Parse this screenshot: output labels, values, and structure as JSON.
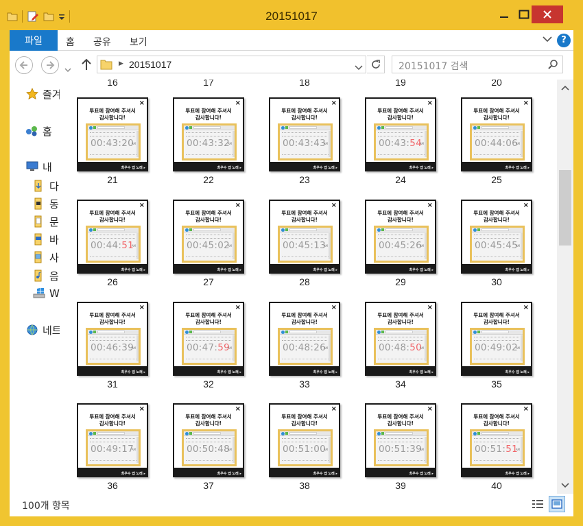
{
  "window": {
    "title": "20151017"
  },
  "ribbon": {
    "tabs": [
      "파일",
      "홈",
      "공유",
      "보기"
    ],
    "help": "?"
  },
  "address": {
    "crumb": "20151017",
    "search_placeholder": "20151017 검색"
  },
  "nav": {
    "items": [
      {
        "label": "즐겨",
        "icon": "star-icon"
      },
      {
        "label": "홈",
        "icon": "homegroup-icon"
      },
      {
        "label": "내",
        "icon": "computer-icon"
      },
      {
        "label": "다",
        "icon": "downloads-folder-icon"
      },
      {
        "label": "동",
        "icon": "videos-folder-icon"
      },
      {
        "label": "문",
        "icon": "documents-folder-icon"
      },
      {
        "label": "바",
        "icon": "desktop-folder-icon"
      },
      {
        "label": "사",
        "icon": "pictures-folder-icon"
      },
      {
        "label": "음",
        "icon": "music-folder-icon"
      },
      {
        "label": "W",
        "icon": "windows-drive-icon"
      },
      {
        "label": "네트",
        "icon": "network-icon"
      }
    ]
  },
  "header_labels": [
    "16",
    "17",
    "18",
    "19",
    "20"
  ],
  "thumbnail": {
    "heading_line1": "투표에 참여해 주셔서",
    "heading_line2": "감사합니다!",
    "footer": "최우수 앱 노래 ▸",
    "close": "×",
    "am": "AM"
  },
  "files": [
    {
      "name": "21",
      "hm": "00:43:",
      "sec": "20",
      "red": false
    },
    {
      "name": "22",
      "hm": "00:43:",
      "sec": "32",
      "red": false
    },
    {
      "name": "23",
      "hm": "00:43:",
      "sec": "43",
      "red": false
    },
    {
      "name": "24",
      "hm": "00:43:",
      "sec": "54",
      "red": true
    },
    {
      "name": "25",
      "hm": "00:44:",
      "sec": "06",
      "red": false
    },
    {
      "name": "26",
      "hm": "00:44:",
      "sec": "51",
      "red": true
    },
    {
      "name": "27",
      "hm": "00:45:",
      "sec": "02",
      "red": false
    },
    {
      "name": "28",
      "hm": "00:45:",
      "sec": "13",
      "red": false
    },
    {
      "name": "29",
      "hm": "00:45:",
      "sec": "26",
      "red": false
    },
    {
      "name": "30",
      "hm": "00:45:",
      "sec": "45",
      "red": false
    },
    {
      "name": "31",
      "hm": "00:46:",
      "sec": "39",
      "red": false
    },
    {
      "name": "32",
      "hm": "00:47:",
      "sec": "59",
      "red": true
    },
    {
      "name": "33",
      "hm": "00:48:",
      "sec": "26",
      "red": false
    },
    {
      "name": "34",
      "hm": "00:48:",
      "sec": "50",
      "red": true
    },
    {
      "name": "35",
      "hm": "00:49:",
      "sec": "02",
      "red": false
    },
    {
      "name": "36",
      "hm": "00:49:",
      "sec": "17",
      "red": false
    },
    {
      "name": "37",
      "hm": "00:50:",
      "sec": "48",
      "red": false
    },
    {
      "name": "38",
      "hm": "00:51:",
      "sec": "00",
      "red": false
    },
    {
      "name": "39",
      "hm": "00:51:",
      "sec": "39",
      "red": false
    },
    {
      "name": "40",
      "hm": "00:51:",
      "sec": "51",
      "red": true
    }
  ],
  "status": {
    "count": "100개 항목"
  },
  "colors": {
    "accent": "#1979ca",
    "titlebar": "#f1c12d",
    "close": "#c7352f",
    "seconds_red": "#f1666a"
  }
}
